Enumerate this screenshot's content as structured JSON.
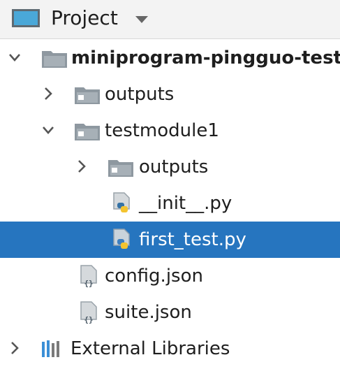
{
  "header": {
    "title": "Project",
    "icon": "window-icon",
    "dropdown_icon": "caret-down-icon"
  },
  "colors": {
    "selection": "#2675bf",
    "folder": "#8e98a0",
    "python_blue": "#3572a5",
    "python_yellow": "#f4c430"
  },
  "tree": {
    "root": {
      "label": "miniprogram-pingguo-test",
      "expanded": true
    },
    "items": [
      {
        "label": "outputs",
        "type": "folder",
        "expanded": false
      },
      {
        "label": "testmodule1",
        "type": "folder",
        "expanded": true
      },
      {
        "label": "outputs",
        "type": "folder",
        "expanded": false
      },
      {
        "label": "__init__.py",
        "type": "python-file"
      },
      {
        "label": "first_test.py",
        "type": "python-file",
        "selected": true
      },
      {
        "label": "config.json",
        "type": "json-file"
      },
      {
        "label": "suite.json",
        "type": "json-file"
      }
    ],
    "external": {
      "label": "External Libraries",
      "expanded": false
    }
  }
}
